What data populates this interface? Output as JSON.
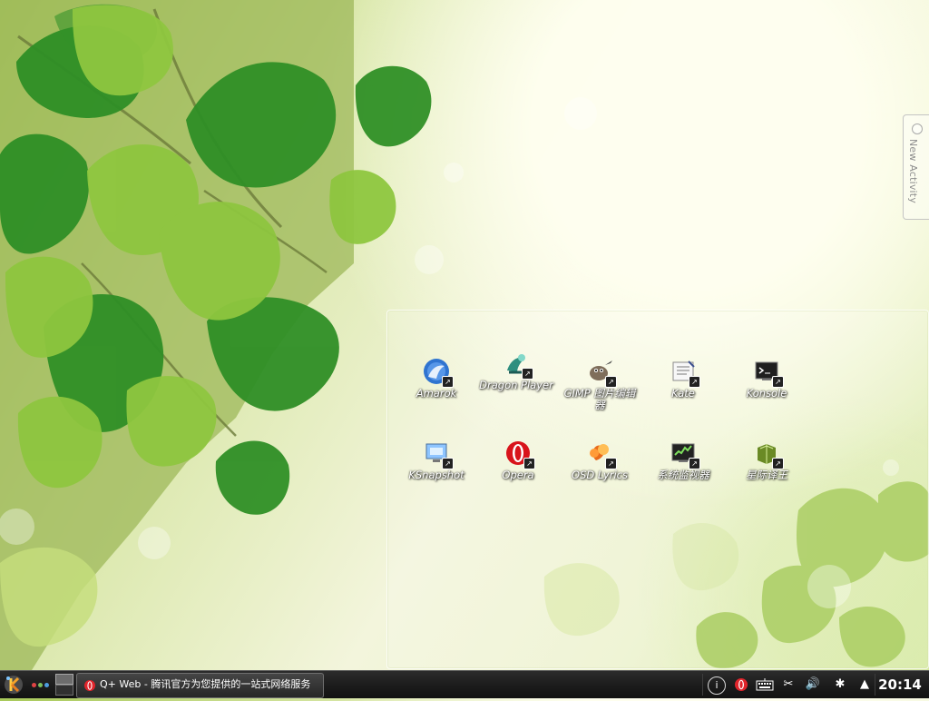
{
  "desktop": {
    "new_activity_label": "New Activity",
    "icons": [
      {
        "label": "Amarok",
        "icon": "amarok-icon"
      },
      {
        "label": "Dragon Player",
        "icon": "dragon-player-icon"
      },
      {
        "label": "GIMP 图片编辑器",
        "icon": "gimp-icon"
      },
      {
        "label": "Kate",
        "icon": "kate-icon"
      },
      {
        "label": "Konsole",
        "icon": "konsole-icon"
      },
      {
        "label": "KSnapshot",
        "icon": "ksnapshot-icon"
      },
      {
        "label": "Opera",
        "icon": "opera-icon"
      },
      {
        "label": "OSD Lyrics",
        "icon": "osd-lyrics-icon"
      },
      {
        "label": "系统监视器",
        "icon": "system-monitor-icon"
      },
      {
        "label": "星际译王",
        "icon": "stardict-icon"
      }
    ]
  },
  "taskbar": {
    "task_label": "Q+ Web - 腾讯官方为您提供的一站式网络服务",
    "clock": "20:14"
  },
  "tray": {
    "icons": [
      "info-icon",
      "opera-tray-icon",
      "keyboard-icon",
      "scissors-icon",
      "volume-icon",
      "bluetooth-icon",
      "arrow-up-icon"
    ]
  },
  "colors": {
    "taskbar_bg": "#1b1b1b",
    "desktop_panel_border": "#ffffff"
  }
}
